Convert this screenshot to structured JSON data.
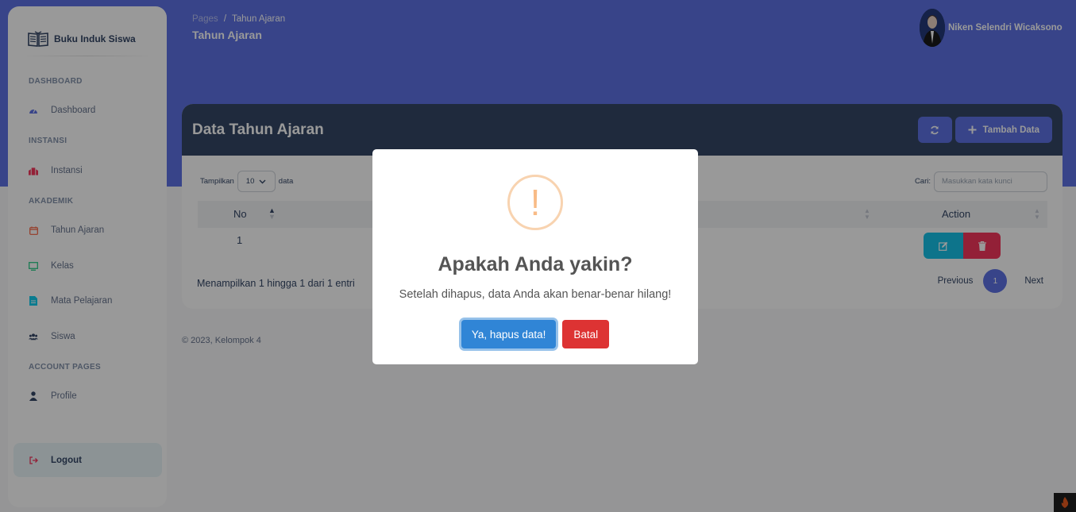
{
  "sidebar": {
    "brand": "Buku Induk Siswa",
    "sections": {
      "dashboard": "DASHBOARD",
      "instansi": "INSTANSI",
      "akademik": "AKADEMIK",
      "account": "ACCOUNT PAGES"
    },
    "items": {
      "dashboard": "Dashboard",
      "instansi": "Instansi",
      "tahun_ajaran": "Tahun Ajaran",
      "kelas": "Kelas",
      "mata_pelajaran": "Mata Pelajaran",
      "siswa": "Siswa",
      "profile": "Profile",
      "logout": "Logout"
    }
  },
  "header": {
    "breadcrumb_root": "Pages",
    "breadcrumb_sep": "/",
    "breadcrumb_current": "Tahun Ajaran",
    "title": "Tahun Ajaran",
    "user_name": "Niken Selendri Wicaksono"
  },
  "card": {
    "title": "Data Tahun Ajaran",
    "add_label": "Tambah Data",
    "length_prefix": "Tampilkan",
    "length_value": "10",
    "length_suffix": "data",
    "search_label": "Cari:",
    "search_placeholder": "Masukkan kata kunci",
    "columns": {
      "no": "No",
      "action": "Action"
    },
    "rows": [
      {
        "no": "1"
      }
    ],
    "info": "Menampilkan 1 hingga 1 dari 1 entri",
    "pager": {
      "previous": "Previous",
      "current": "1",
      "next": "Next"
    }
  },
  "footer": "© 2023, Kelompok 4",
  "modal": {
    "icon": "!",
    "title": "Apakah Anda yakin?",
    "text": "Setelah dihapus, data Anda akan benar-benar hilang!",
    "confirm": "Ya, hapus data!",
    "cancel": "Batal"
  },
  "colors": {
    "primary": "#5e72e4",
    "dark": "#344767",
    "info": "#17c1e8",
    "danger": "#f5365c",
    "confirm": "#3085d6",
    "cancel": "#dd3333",
    "warning": "#f8bb86"
  },
  "icons": [
    "book-icon",
    "gauge-icon",
    "building-icon",
    "calendar-icon",
    "monitor-icon",
    "document-icon",
    "users-icon",
    "person-icon",
    "logout-icon",
    "refresh-icon",
    "plus-icon",
    "chevron-down-icon",
    "sort-icon",
    "edit-icon",
    "trash-icon",
    "warning-icon",
    "fire-icon"
  ]
}
